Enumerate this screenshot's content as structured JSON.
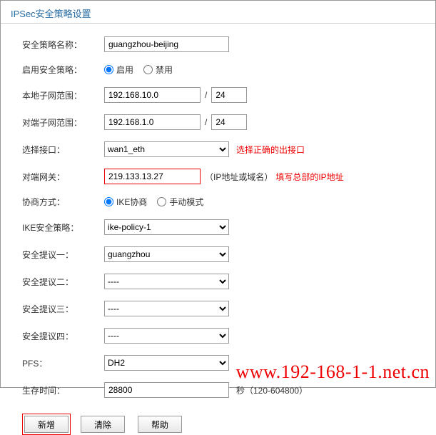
{
  "header": {
    "title": "IPSec安全策略设置"
  },
  "labels": {
    "policy_name": "安全策略名称：",
    "enable_policy": "启用安全策略：",
    "local_subnet": "本地子网范围：",
    "peer_subnet": "对端子网范围：",
    "interface": "选择接口：",
    "peer_gateway": "对端网关：",
    "negotiation": "协商方式：",
    "ike_policy": "IKE安全策略：",
    "proposal1": "安全提议一：",
    "proposal2": "安全提议二：",
    "proposal3": "安全提议三：",
    "proposal4": "安全提议四：",
    "pfs": "PFS：",
    "lifetime": "生存时间："
  },
  "values": {
    "policy_name": "guangzhou-beijing",
    "local_subnet_ip": "192.168.10.0",
    "local_subnet_mask": "24",
    "peer_subnet_ip": "192.168.1.0",
    "peer_subnet_mask": "24",
    "interface": "wan1_eth",
    "peer_gateway": "219.133.13.27",
    "ike_policy": "ike-policy-1",
    "proposal1": "guangzhou",
    "proposal2": "----",
    "proposal3": "----",
    "proposal4": "----",
    "pfs": "DH2",
    "lifetime": "28800"
  },
  "radios": {
    "enable": "启用",
    "disable": "禁用",
    "ike": "IKE协商",
    "manual": "手动模式"
  },
  "notes": {
    "interface": "选择正确的出接口",
    "gateway_hint": "（IP地址或域名）",
    "gateway_red": "填写总部的IP地址",
    "lifetime_unit": "秒（120-604800）"
  },
  "buttons": {
    "add": "新增",
    "clear": "清除",
    "help": "帮助"
  },
  "watermark": "www.192-168-1-1.net.cn"
}
